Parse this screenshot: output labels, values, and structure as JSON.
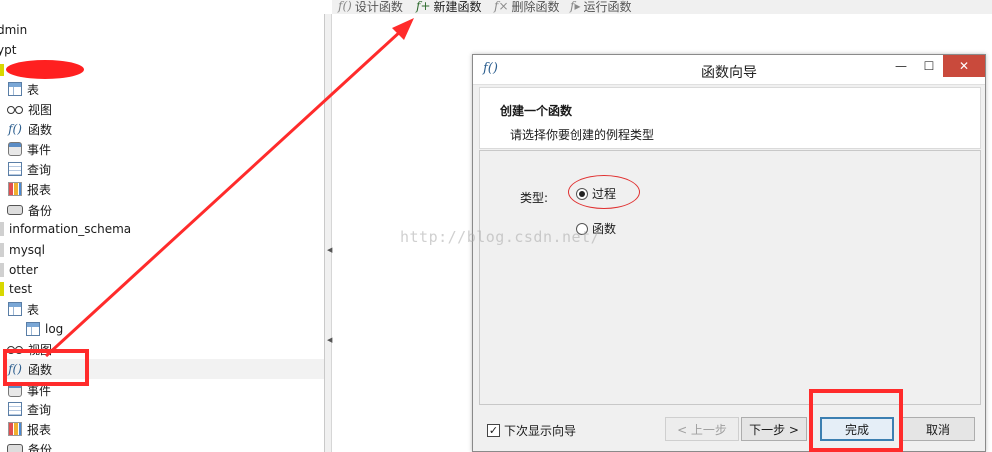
{
  "toolbar": {
    "design_function": "设计函数",
    "new_function": "新建函数",
    "delete_function": "删除函数",
    "run_function": "运行函数"
  },
  "tree": {
    "db_admin": "dmin",
    "db_ypt": "ypt",
    "group1": {
      "tables": "表",
      "views": "视图",
      "functions": "函数",
      "events": "事件",
      "queries": "查询",
      "reports": "报表",
      "backups": "备份"
    },
    "db_information_schema": "information_schema",
    "db_mysql": "mysql",
    "db_otter": "otter",
    "db_test": "test",
    "test_group": {
      "tables": "表",
      "table_log": "log",
      "views": "视图",
      "functions": "函数",
      "events": "事件",
      "queries": "查询",
      "reports": "报表",
      "backups": "备份"
    }
  },
  "dialog": {
    "title": "函数向导",
    "header_title": "创建一个函数",
    "header_subtitle": "请选择你要创建的例程类型",
    "type_label": "类型:",
    "option_procedure": "过程",
    "option_function": "函数",
    "selected": "过程",
    "show_next_time": "下次显示向导",
    "btn_prev": "< 上一步",
    "btn_next": "下一步 >",
    "btn_finish": "完成",
    "btn_cancel": "取消"
  },
  "watermark": "http://blog.csdn.net/",
  "colors": {
    "annotation_red": "#ff2b2b",
    "close_button": "#c94a3c",
    "function_icon": "#2d5f8f"
  }
}
